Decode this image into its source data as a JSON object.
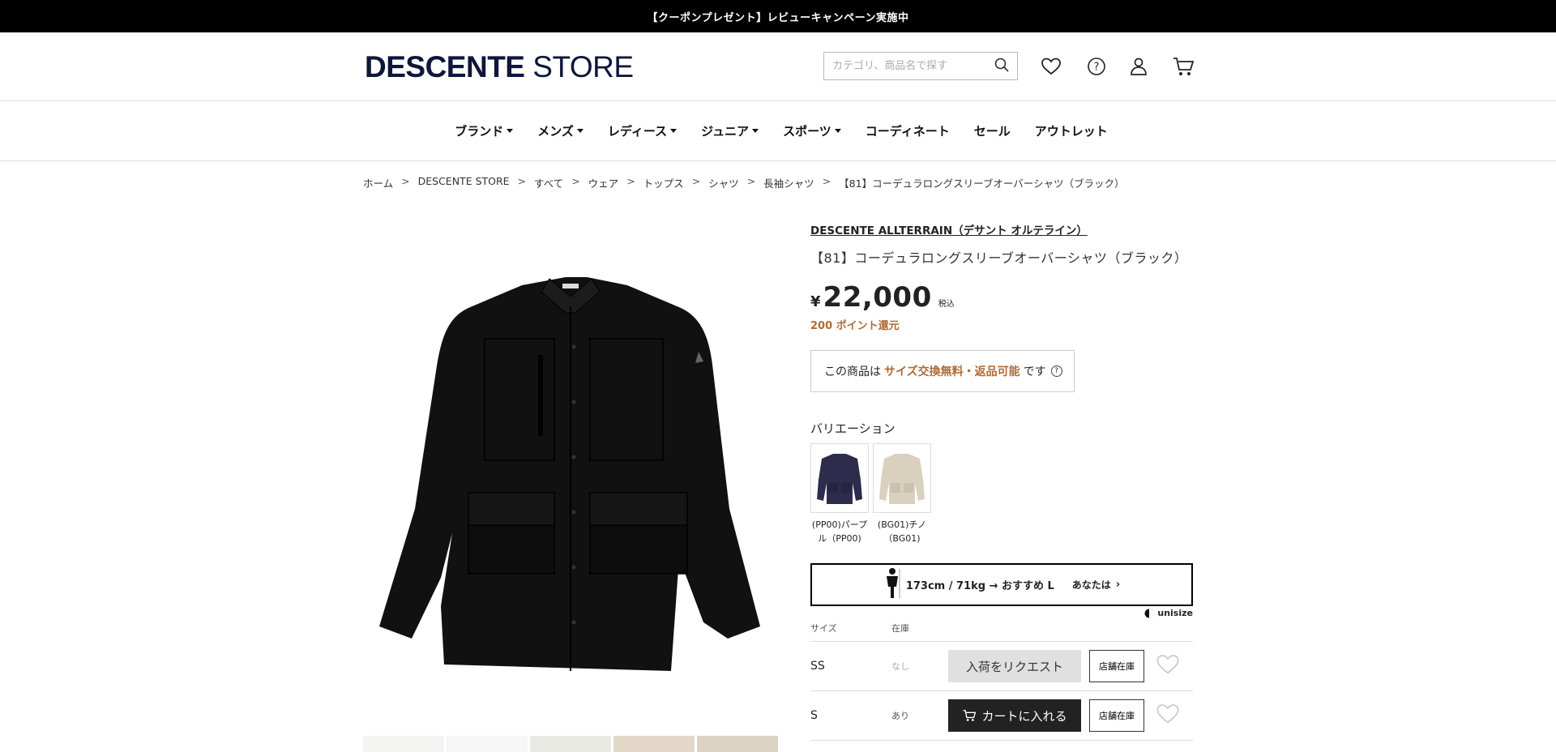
{
  "topbar": {
    "text": "【クーポンプレゼント】レビューキャンペーン実施中"
  },
  "header": {
    "logo_bold": "DESCENTE",
    "logo_light": "STORE",
    "search_placeholder": "カテゴリ、商品名で探す",
    "icons": [
      "heart-icon",
      "help-icon",
      "user-icon",
      "cart-icon"
    ]
  },
  "nav": [
    {
      "label": "ブランド",
      "dropdown": true
    },
    {
      "label": "メンズ",
      "dropdown": true
    },
    {
      "label": "レディース",
      "dropdown": true
    },
    {
      "label": "ジュニア",
      "dropdown": true
    },
    {
      "label": "スポーツ",
      "dropdown": true
    },
    {
      "label": "コーディネート",
      "dropdown": false
    },
    {
      "label": "セール",
      "dropdown": false
    },
    {
      "label": "アウトレット",
      "dropdown": false
    }
  ],
  "breadcrumb": [
    "ホーム",
    "DESCENTE STORE",
    "すべて",
    "ウェア",
    "トップス",
    "シャツ",
    "長袖シャツ",
    "【81】コーデュラロングスリーブオーバーシャツ（ブラック）"
  ],
  "product": {
    "brand": "DESCENTE ALLTERRAIN（デサント オルテライン）",
    "name": "【81】コーデュラロングスリーブオーバーシャツ（ブラック）",
    "currency": "¥",
    "price": "22,000",
    "tax": "税込",
    "points": "200 ポイント還元",
    "notice_pre": "この商品は",
    "notice_highlight": "サイズ交換無料・返品可能",
    "notice_post": "です",
    "help": "?"
  },
  "variations": {
    "title": "バリエーション",
    "items": [
      {
        "label": "(PP00)パープル（PP00)",
        "color": "#2e2c4d"
      },
      {
        "label": "(BG01)チノ（BG01)",
        "color": "#d9d0bd"
      }
    ]
  },
  "unisize": {
    "recommend": "173cm / 71kg → おすすめ L",
    "you": "あなたは",
    "chevron": "›",
    "logo": "unisize"
  },
  "stock_table": {
    "col_size": "サイズ",
    "col_stock": "在庫",
    "rows": [
      {
        "size": "SS",
        "stock": "なし",
        "action": "入荷をリクエスト",
        "store": "店舗在庫"
      },
      {
        "size": "S",
        "stock": "あり",
        "action": "カートに入れる",
        "store": "店舗在庫"
      }
    ]
  }
}
